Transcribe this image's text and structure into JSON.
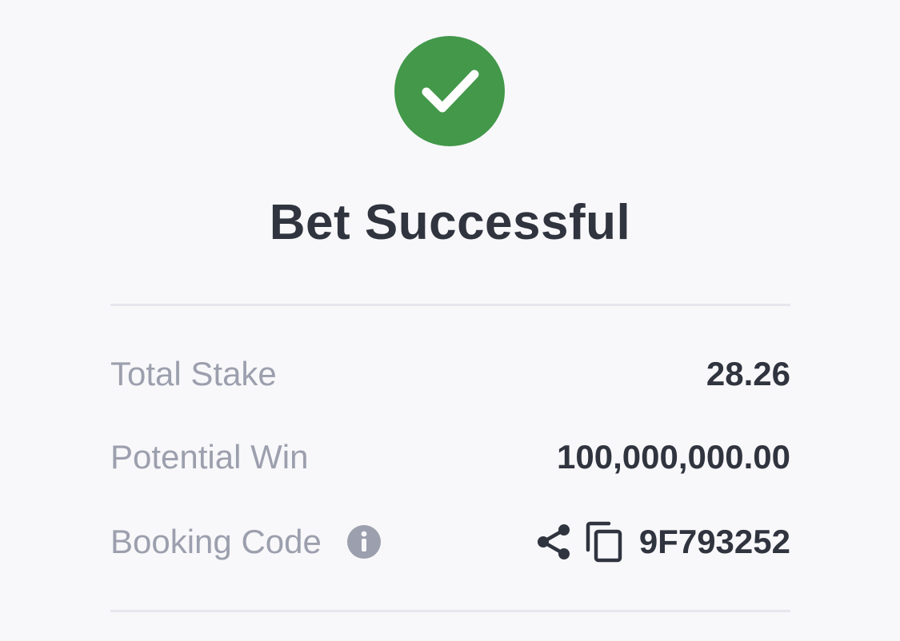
{
  "colors": {
    "success": "#43984a",
    "title_text": "#30343f",
    "label_text": "#9c9fad",
    "divider": "#e6e7ee",
    "background": "#f8f8fa"
  },
  "header": {
    "icon": "check-circle-icon",
    "title": "Bet Successful"
  },
  "summary": {
    "total_stake": {
      "label": "Total Stake",
      "value": "28.26"
    },
    "potential_win": {
      "label": "Potential Win",
      "value": "100,000,000.00"
    },
    "booking_code": {
      "label": "Booking Code",
      "info_icon": "info-icon",
      "share_icon": "share-icon",
      "copy_icon": "copy-icon",
      "value": "9F793252"
    }
  }
}
